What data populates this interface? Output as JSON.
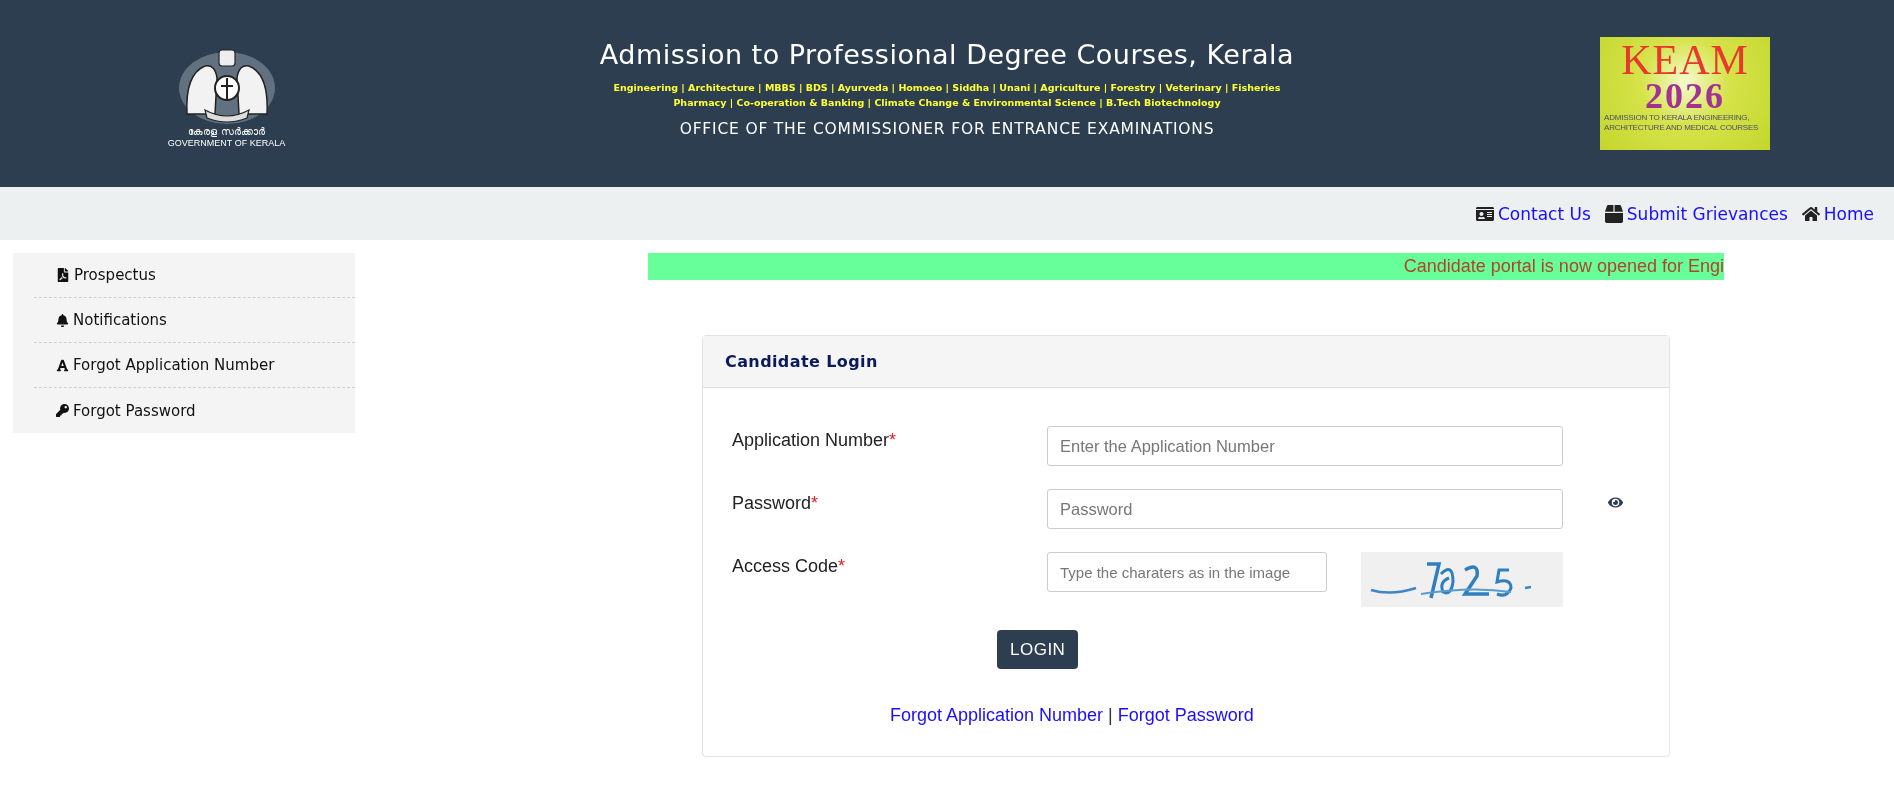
{
  "header": {
    "emblem": {
      "script_line": "കേരള സർക്കാർ",
      "caption": "GOVERNMENT OF KERALA"
    },
    "title": "Admission to Professional Degree Courses, Kerala",
    "courses": [
      "Engineering | Architecture | MBBS | BDS | Ayurveda | Homoeo | Siddha | Unani | Agriculture | Forestry | Veterinary | Fisheries",
      "Pharmacy | Co-operation & Banking | Climate Change & Environmental Science | B.Tech Biotechnology"
    ],
    "office": "OFFICE OF THE COMMISSIONER FOR ENTRANCE EXAMINATIONS",
    "logo": {
      "word": "KEAM",
      "year": "2026",
      "caption_lines": [
        "ADMISSION TO KERALA ENGINEERING,",
        "ARCHITECTURE AND MEDICAL COURSES"
      ]
    }
  },
  "nav": [
    {
      "kind": "contact",
      "label": "Contact Us"
    },
    {
      "kind": "grievance",
      "label": "Submit Grievances"
    },
    {
      "kind": "home",
      "label": "Home"
    }
  ],
  "sidebar": {
    "items": [
      {
        "kind": "pdf",
        "label": "Prospectus"
      },
      {
        "kind": "bell",
        "label": "Notifications"
      },
      {
        "kind": "font",
        "label": "Forgot Application Number"
      },
      {
        "kind": "key",
        "label": "Forgot Password"
      }
    ]
  },
  "ticker": "Candidate portal is now opened for Engi",
  "login": {
    "title": "Candidate Login",
    "fields": [
      {
        "kind": "text",
        "label": "Application Number",
        "required_mark": "*",
        "placeholder": "Enter the Application Number"
      },
      {
        "kind": "password",
        "label": "Password",
        "required_mark": "*",
        "placeholder": "Password"
      },
      {
        "kind": "captcha",
        "label": "Access Code",
        "required_mark": "*",
        "placeholder": "Type the charaters as in the image"
      }
    ],
    "button": "LOGIN",
    "links": [
      "Forgot Application Number",
      "Forgot Password"
    ],
    "separator": "|"
  }
}
